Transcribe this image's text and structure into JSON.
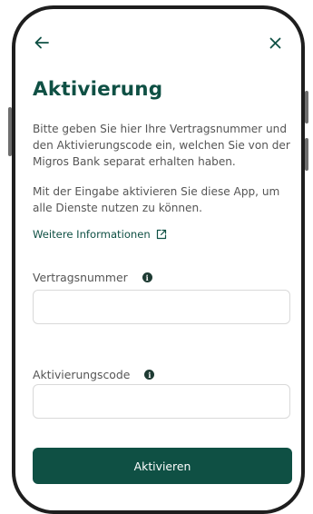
{
  "nav": {
    "back_icon": "arrow-left-icon",
    "close_icon": "close-icon"
  },
  "page": {
    "title": "Aktivierung",
    "paragraph1": "Bitte geben Sie hier Ihre Vertragsnummer und den Aktivierungscode ein, welchen Sie von der Migros Bank separat erhalten haben.",
    "paragraph2": "Mit der Eingabe aktivieren Sie diese App, um alle Dienste nutzen zu können.",
    "info_link": "Weitere Informationen",
    "info_link_icon": "external-link-icon"
  },
  "form": {
    "contract_label": "Vertragsnummer",
    "contract_value": "",
    "activation_label": "Aktivierungscode",
    "activation_value": "",
    "info_icon": "info-icon",
    "submit_label": "Aktivieren"
  },
  "colors": {
    "brand": "#0f5044",
    "text": "#555555",
    "border": "#d9d9d9"
  }
}
